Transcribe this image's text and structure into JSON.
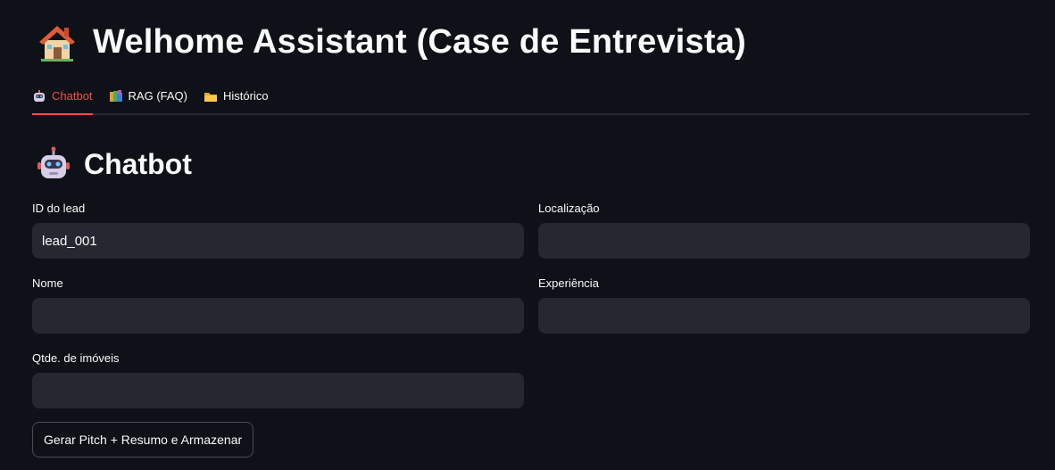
{
  "header": {
    "title": "Welhome Assistant (Case de Entrevista)",
    "icon": "house-icon"
  },
  "tabs": [
    {
      "label": "Chatbot",
      "icon": "robot-icon",
      "active": true
    },
    {
      "label": "RAG (FAQ)",
      "icon": "books-icon",
      "active": false
    },
    {
      "label": "Histórico",
      "icon": "folder-icon",
      "active": false
    }
  ],
  "section": {
    "title": "Chatbot",
    "icon": "robot-icon"
  },
  "form": {
    "lead_id": {
      "label": "ID do lead",
      "value": "lead_001"
    },
    "localizacao": {
      "label": "Localização",
      "value": ""
    },
    "nome": {
      "label": "Nome",
      "value": ""
    },
    "experiencia": {
      "label": "Experiência",
      "value": ""
    },
    "qtd_imoveis": {
      "label": "Qtde. de imóveis",
      "value": ""
    },
    "submit_label": "Gerar Pitch + Resumo e Armazenar"
  },
  "colors": {
    "background": "#0e1117",
    "input_bg": "#262730",
    "accent": "#ff4b4b",
    "text": "#fafafa"
  }
}
